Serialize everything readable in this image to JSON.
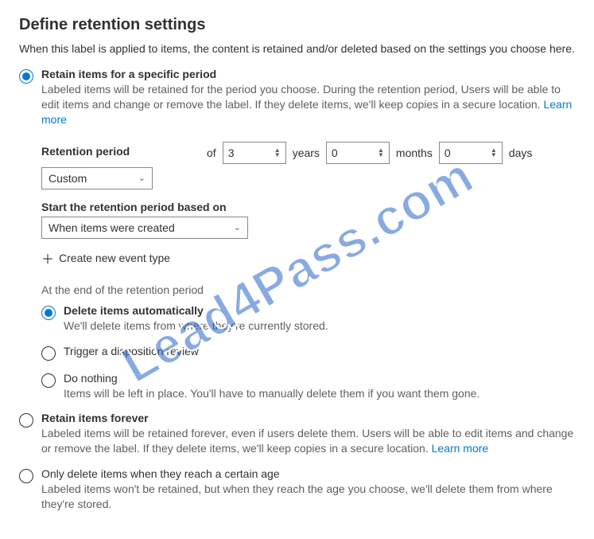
{
  "heading": "Define retention settings",
  "subtitle": "When this label is applied to items, the content is retained and/or deleted based on the settings you choose here.",
  "mainOptions": {
    "retainSpecific": {
      "label": "Retain items for a specific period",
      "desc": "Labeled items will be retained for the period you choose. During the retention period, Users will be able to edit items and change or remove the label. If they delete items, we'll keep copies in a secure location.",
      "learnMore": "Learn more"
    },
    "retainForever": {
      "label": "Retain items forever",
      "desc": "Labeled items will be retained forever, even if users delete them. Users will be able to edit items and change or remove the label. If they delete items, we'll keep copies in a secure location.",
      "learnMore": "Learn more"
    },
    "onlyDelete": {
      "label": "Only delete items when they reach a certain age",
      "desc": "Labeled items won't be retained, but when they reach the age you choose, we'll delete them from where they're stored."
    }
  },
  "retention": {
    "periodLabel": "Retention period",
    "of": "of",
    "years": "3",
    "yearsUnit": "years",
    "months": "0",
    "monthsUnit": "months",
    "days": "0",
    "daysUnit": "days",
    "periodSelect": "Custom",
    "basedOnLabel": "Start the retention period based on",
    "basedOnSelect": "When items were created",
    "createEvent": "Create new event type"
  },
  "endPeriod": {
    "heading": "At the end of the retention period",
    "deleteAuto": {
      "label": "Delete items automatically",
      "desc": "We'll delete items from where they're currently stored."
    },
    "disposition": {
      "label": "Trigger a disposition review"
    },
    "doNothing": {
      "label": "Do nothing",
      "desc": "Items will be left in place. You'll have to manually delete them if you want them gone."
    }
  },
  "watermark": "Lead4Pass.com"
}
